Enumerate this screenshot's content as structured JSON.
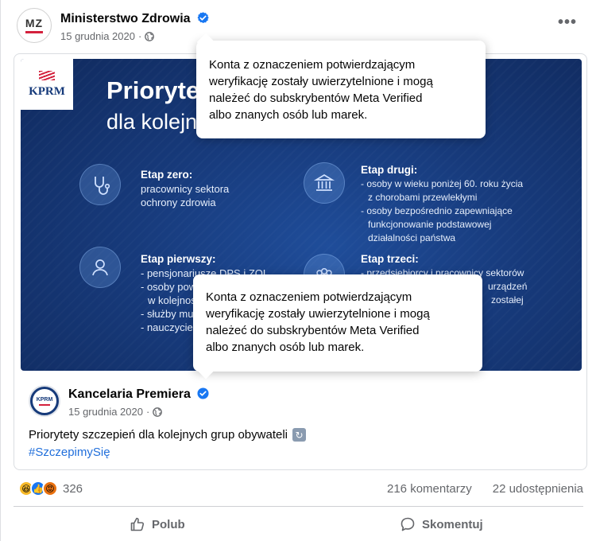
{
  "post": {
    "author": "Ministerstwo Zdrowia",
    "avatar_text": "MZ",
    "date": "15 grudnia 2020",
    "separator": "·",
    "more": "•••"
  },
  "graphic": {
    "logo_text": "KPRM",
    "title": "Prioryte",
    "subtitle": "dla kolejn",
    "stages": [
      {
        "heading": "Etap zero:",
        "lines": [
          "pracownicy sektora",
          "ochrony zdrowia"
        ]
      },
      {
        "heading": "Etap drugi:",
        "lines": [
          "- osoby w wieku poniżej 60. roku życia",
          "z chorobami przewlekłymi",
          "- osoby bezpośrednio zapewniające",
          "funkcjonowanie podstawowej",
          "działalności państwa"
        ]
      },
      {
        "heading": "Etap pierwszy:",
        "lines": [
          "- pensjonariusze DPS i ZOL",
          "- osoby powy",
          "w kolejności",
          "- służby mund",
          "- nauczyciele"
        ]
      },
      {
        "heading": "Etap trzeci:",
        "lines": [
          "- przedsiębiorcy i pracownicy sektorów",
          "urządzeń",
          "zostałej"
        ]
      }
    ]
  },
  "tooltip": {
    "text_lines": [
      "Konta z oznaczeniem potwierdzającym",
      "weryfikację zostały uwierzytelnione i mogą",
      "należeć do subskrybentów Meta Verified",
      "albo znanych osób lub marek."
    ]
  },
  "shared": {
    "author": "Kancelaria Premiera",
    "avatar_text": "KPRM",
    "date": "15 grudnia 2020",
    "separator": "·",
    "text": "Priorytety szczepień dla kolejnych grup obywateli",
    "hashtag": "#SzczepimySię"
  },
  "stats": {
    "reaction_count": "326",
    "comments": "216 komentarzy",
    "shares": "22 udostępnienia"
  },
  "actions": {
    "like": "Polub",
    "comment": "Skomentuj"
  },
  "colors": {
    "verified": "#1877f2",
    "link": "#216fdb",
    "graphic_bg": "#173a7b"
  },
  "icons": [
    "verified-badge-icon",
    "globe-icon",
    "more-options-icon",
    "stethoscope-icon",
    "building-icon",
    "person-icon",
    "group-icon",
    "haha-reaction-icon",
    "like-reaction-icon",
    "angry-reaction-icon",
    "thumbs-up-icon",
    "comment-icon",
    "refresh-emoji-icon"
  ]
}
